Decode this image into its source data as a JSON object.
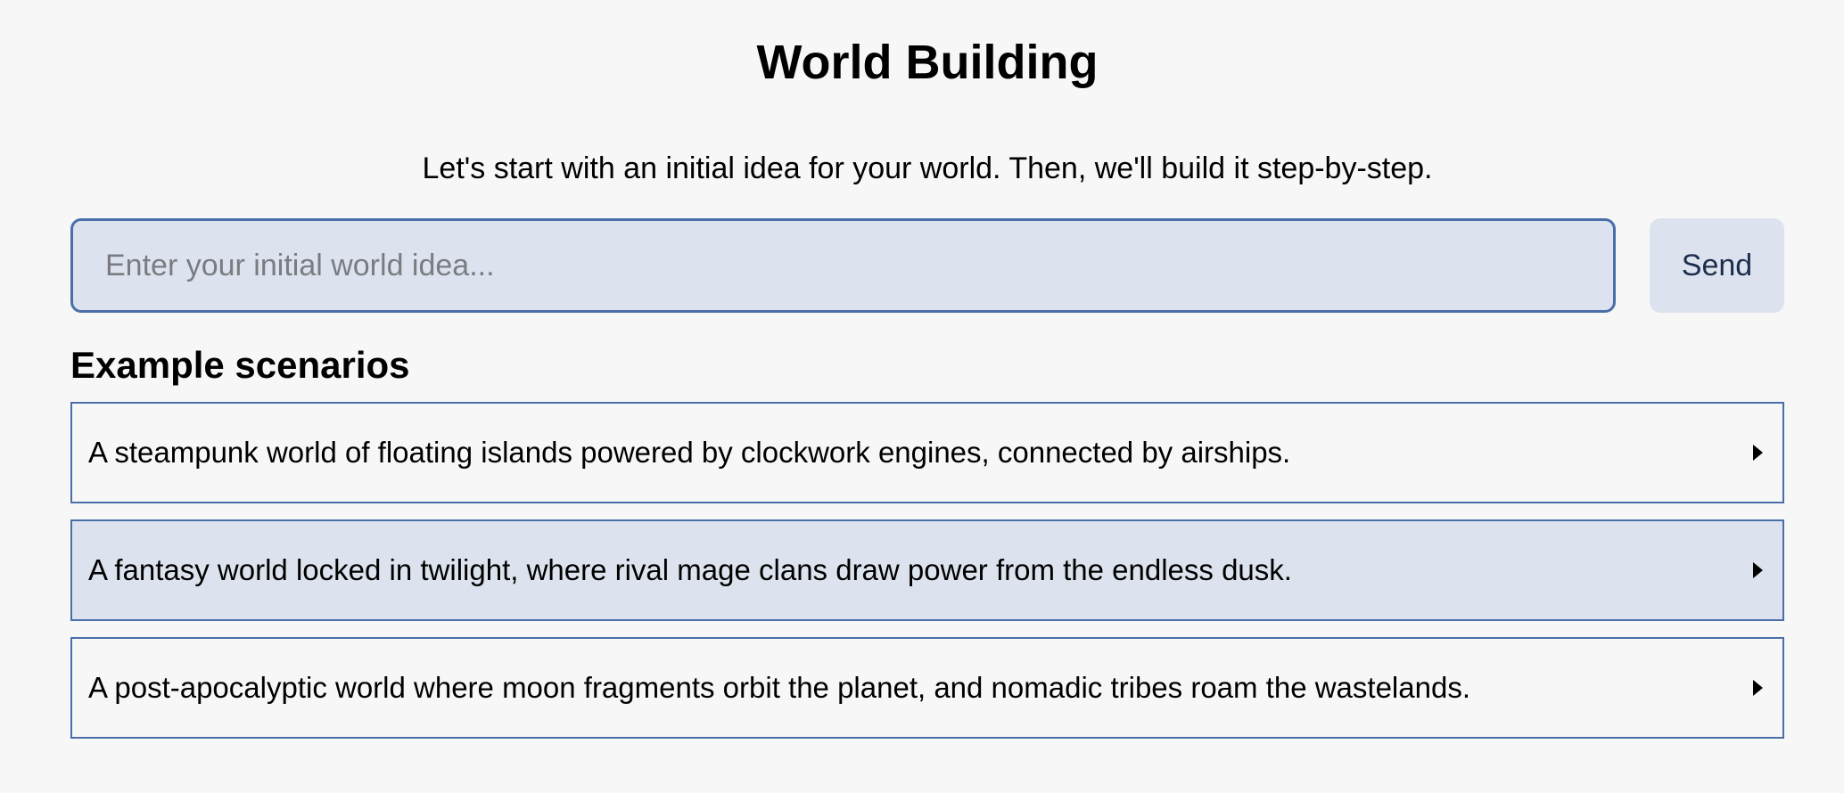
{
  "header": {
    "title": "World Building",
    "subtitle": "Let's start with an initial idea for your world. Then, we'll build it step-by-step."
  },
  "input": {
    "value": "",
    "placeholder": "Enter your initial world idea...",
    "send_label": "Send"
  },
  "examples": {
    "heading": "Example scenarios",
    "items": [
      {
        "text": "A steampunk world of floating islands powered by clockwork engines, connected by airships.",
        "icon": "caret-right-icon",
        "hovered": false
      },
      {
        "text": "A fantasy world locked in twilight, where rival mage clans draw power from the endless dusk.",
        "icon": "caret-right-icon",
        "hovered": true
      },
      {
        "text": "A post-apocalyptic world where moon fragments orbit the planet, and nomadic tribes roam the wastelands.",
        "icon": "caret-right-icon",
        "hovered": false
      }
    ]
  },
  "colors": {
    "background": "#f8f7f8",
    "accent_border": "#4a6fa8",
    "field_fill": "#dde3ee",
    "send_text": "#1c2d4d"
  }
}
